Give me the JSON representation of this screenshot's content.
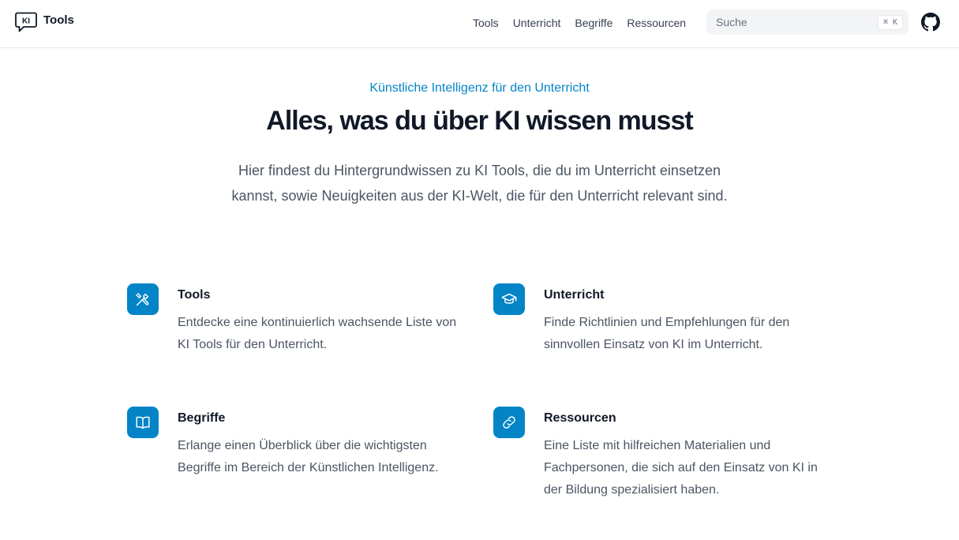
{
  "header": {
    "logo_badge": "KI",
    "logo_text": "Tools",
    "nav": [
      "Tools",
      "Unterricht",
      "Begriffe",
      "Ressourcen"
    ],
    "search": {
      "placeholder": "Suche",
      "shortcut": "⌘ K"
    },
    "github_icon": "github-icon"
  },
  "hero": {
    "eyebrow": "Künstliche Intelligenz für den Unterricht",
    "title": "Alles, was du über KI wissen musst",
    "description": "Hier findest du Hintergrundwissen zu KI Tools, die du im Unterricht einsetzen kannst, sowie Neuigkeiten aus der KI-Welt, die für den Unterricht relevant sind."
  },
  "features": [
    {
      "icon": "tools-icon",
      "title": "Tools",
      "description": "Entdecke eine kontinuierlich wachsende Liste von KI Tools für den Unterricht."
    },
    {
      "icon": "graduation-cap-icon",
      "title": "Unterricht",
      "description": "Finde Richtlinien und Empfehlungen für den sinnvollen Einsatz von KI im Unterricht."
    },
    {
      "icon": "book-icon",
      "title": "Begriffe",
      "description": "Erlange einen Überblick über die wichtigsten Begriffe im Bereich der Künstlichen Intelligenz."
    },
    {
      "icon": "link-icon",
      "title": "Ressourcen",
      "description": "Eine Liste mit hilfreichen Materialien und Fachpersonen, die sich auf den Einsatz von KI in der Bildung spezialisiert haben."
    }
  ],
  "colors": {
    "accent": "#0284c7",
    "text": "#111827",
    "muted": "#4b5563",
    "border": "#e5e7eb"
  }
}
